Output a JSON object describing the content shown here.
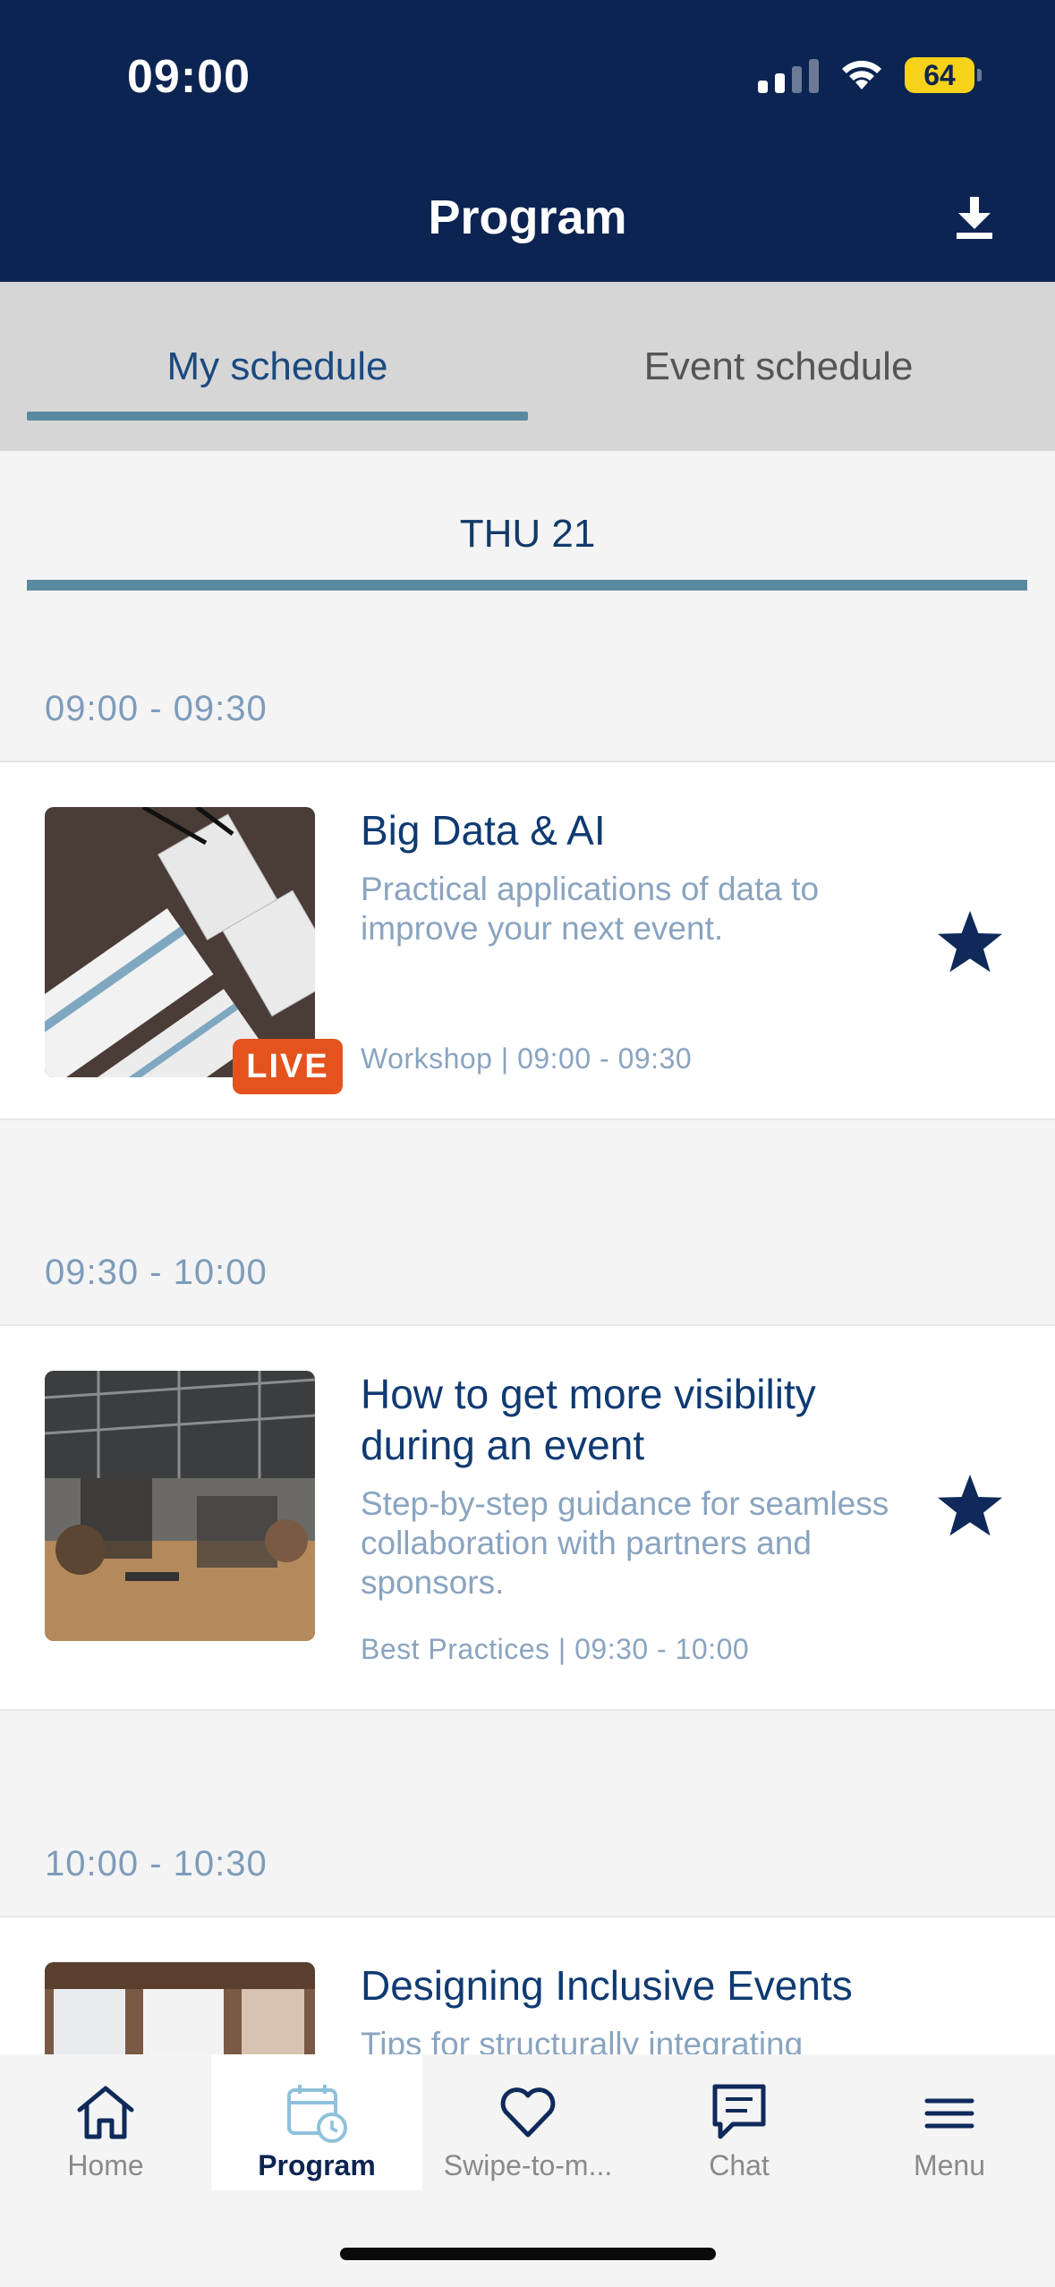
{
  "status_bar": {
    "time": "09:00",
    "battery": "64"
  },
  "header": {
    "title": "Program",
    "download_icon": "download-icon"
  },
  "tabs": [
    {
      "label": "My schedule",
      "active": true
    },
    {
      "label": "Event schedule",
      "active": false
    }
  ],
  "day": {
    "label": "THU 21"
  },
  "sessions": [
    {
      "time_range": "09:00 - 09:30",
      "title": "Big Data & AI",
      "description": "Practical applications of data to improve your next event.",
      "meta": "Workshop | 09:00 - 09:30",
      "badge": "LIVE",
      "starred": true
    },
    {
      "time_range": "09:30 - 10:00",
      "title": "How to get more visibility during an event",
      "description": "Step-by-step guidance for seamless collaboration with partners and sponsors.",
      "meta": "Best Practices | 09:30 - 10:00",
      "starred": true
    },
    {
      "time_range": "10:00 - 10:30",
      "title": "Designing Inclusive Events",
      "description": "Tips for structurally integrating"
    }
  ],
  "bottom_nav": [
    {
      "label": "Home",
      "icon": "home-icon"
    },
    {
      "label": "Program",
      "icon": "calendar-clock-icon",
      "active": true
    },
    {
      "label": "Swipe-to-m...",
      "icon": "heart-icon"
    },
    {
      "label": "Chat",
      "icon": "chat-icon"
    },
    {
      "label": "Menu",
      "icon": "menu-icon"
    }
  ],
  "colors": {
    "header_bg": "#0c2452",
    "accent": "#5a8aa0",
    "title_text": "#0f3a72",
    "muted_text": "#8aa4c0",
    "live_badge": "#e4531d",
    "battery": "#f6d21a"
  }
}
